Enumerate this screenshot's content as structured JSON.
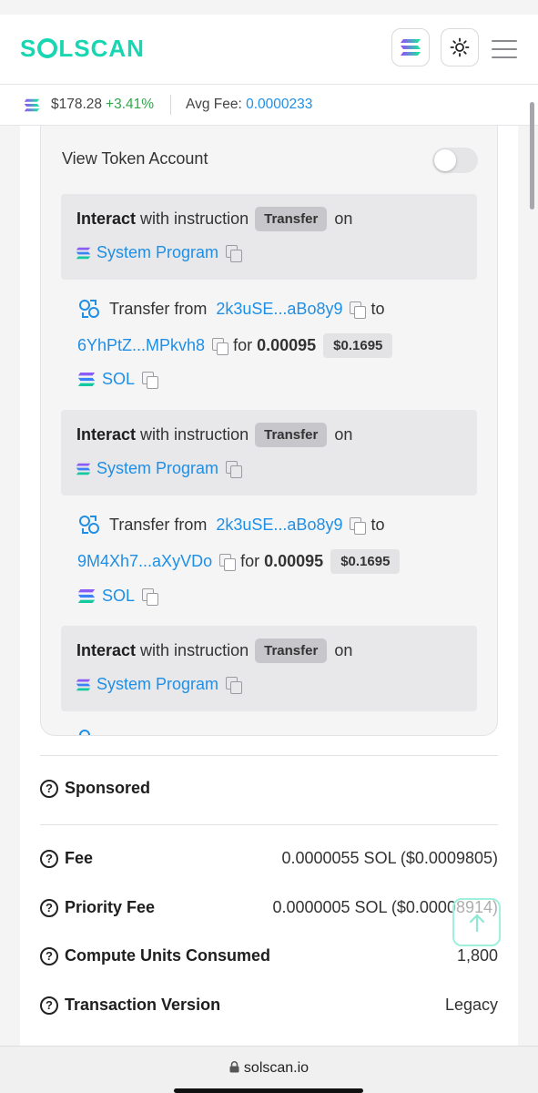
{
  "header": {
    "logo_text": "SOLSCAN",
    "logo_pre": "S",
    "logo_post": "LSCAN"
  },
  "price_bar": {
    "price": "$178.28",
    "change": "+3.41%",
    "avg_fee_label": "Avg Fee:",
    "avg_fee_value": "0.0000233"
  },
  "instructions": {
    "view_token_account_label": "View Token Account",
    "items": [
      {
        "interact_bold": "Interact",
        "interact_text": "with instruction",
        "type": "Transfer",
        "on": "on",
        "program": "System Program",
        "transfer_from_label": "Transfer from",
        "from": "2k3uSE...aBo8y9",
        "to_label": "to",
        "to": "6YhPtZ...MPkvh8",
        "for_label": "for",
        "amount": "0.00095",
        "usd": "$0.1695",
        "token": "SOL"
      },
      {
        "interact_bold": "Interact",
        "interact_text": "with instruction",
        "type": "Transfer",
        "on": "on",
        "program": "System Program",
        "transfer_from_label": "Transfer from",
        "from": "2k3uSE...aBo8y9",
        "to_label": "to",
        "to": "9M4Xh7...aXyVDo",
        "for_label": "for",
        "amount": "0.00095",
        "usd": "$0.1695",
        "token": "SOL"
      },
      {
        "interact_bold": "Interact",
        "interact_text": "with instruction",
        "type": "Transfer",
        "on": "on",
        "program": "System Program"
      }
    ]
  },
  "details": {
    "sponsored_label": "Sponsored",
    "fee_label": "Fee",
    "fee_value": "0.0000055 SOL ($0.0009805)",
    "priority_fee_label": "Priority Fee",
    "priority_fee_value": "0.0000005 SOL ($0.00008914)",
    "compute_units_label": "Compute Units Consumed",
    "compute_units_value": "1,800",
    "tx_version_label": "Transaction Version",
    "tx_version_value": "Legacy"
  },
  "browser": {
    "url": "solscan.io"
  },
  "colors": {
    "brand": "#18d6b1",
    "link": "#1f8fe5",
    "positive": "#2ea84a"
  }
}
